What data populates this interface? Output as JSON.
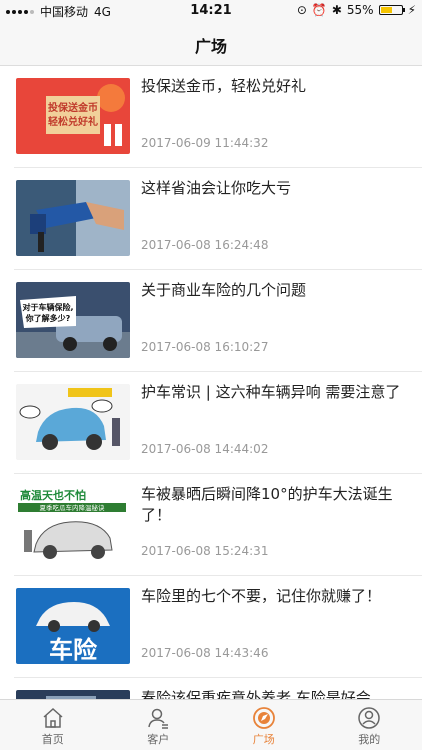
{
  "status_bar": {
    "carrier": "中国移动",
    "network": "4G",
    "time": "14:21",
    "battery": "55%",
    "battery_level": 0.55
  },
  "nav": {
    "title": "广场"
  },
  "articles": [
    {
      "title": "投保送金币，轻松兑好礼",
      "date": "2017-06-09 11:44:32",
      "thumb_text": [
        "投保送金币",
        "轻松兑好礼"
      ]
    },
    {
      "title": "这样省油会让你吃大亏",
      "date": "2017-06-08 16:24:48"
    },
    {
      "title": "关于商业车险的几个问题",
      "date": "2017-06-08 16:10:27",
      "thumb_text": [
        "对于车辆保险,",
        "你了解多少?"
      ]
    },
    {
      "title": "护车常识 | 这六种车辆异响 需要注意了",
      "date": "2017-06-08 14:44:02"
    },
    {
      "title": "车被暴晒后瞬间降10°的护车大法诞生了！",
      "date": "2017-06-08 15:24:31",
      "thumb_text": [
        "高温天也不怕",
        "夏季吃瓜车内降温秘诀"
      ]
    },
    {
      "title": "车险里的七个不要，记住你就赚了！",
      "date": "2017-06-08 14:43:46",
      "thumb_text": [
        "车险"
      ]
    },
    {
      "title": "春险该保重疾意外养老 车险是好会",
      "date": ""
    }
  ],
  "tabs": [
    {
      "label": "首页",
      "icon": "home-icon",
      "active": false
    },
    {
      "label": "客户",
      "icon": "customer-icon",
      "active": false
    },
    {
      "label": "广场",
      "icon": "compass-icon",
      "active": true
    },
    {
      "label": "我的",
      "icon": "profile-icon",
      "active": false
    }
  ],
  "colors": {
    "accent": "#e8833a",
    "title_text": "#222222",
    "date_text": "#999999"
  }
}
